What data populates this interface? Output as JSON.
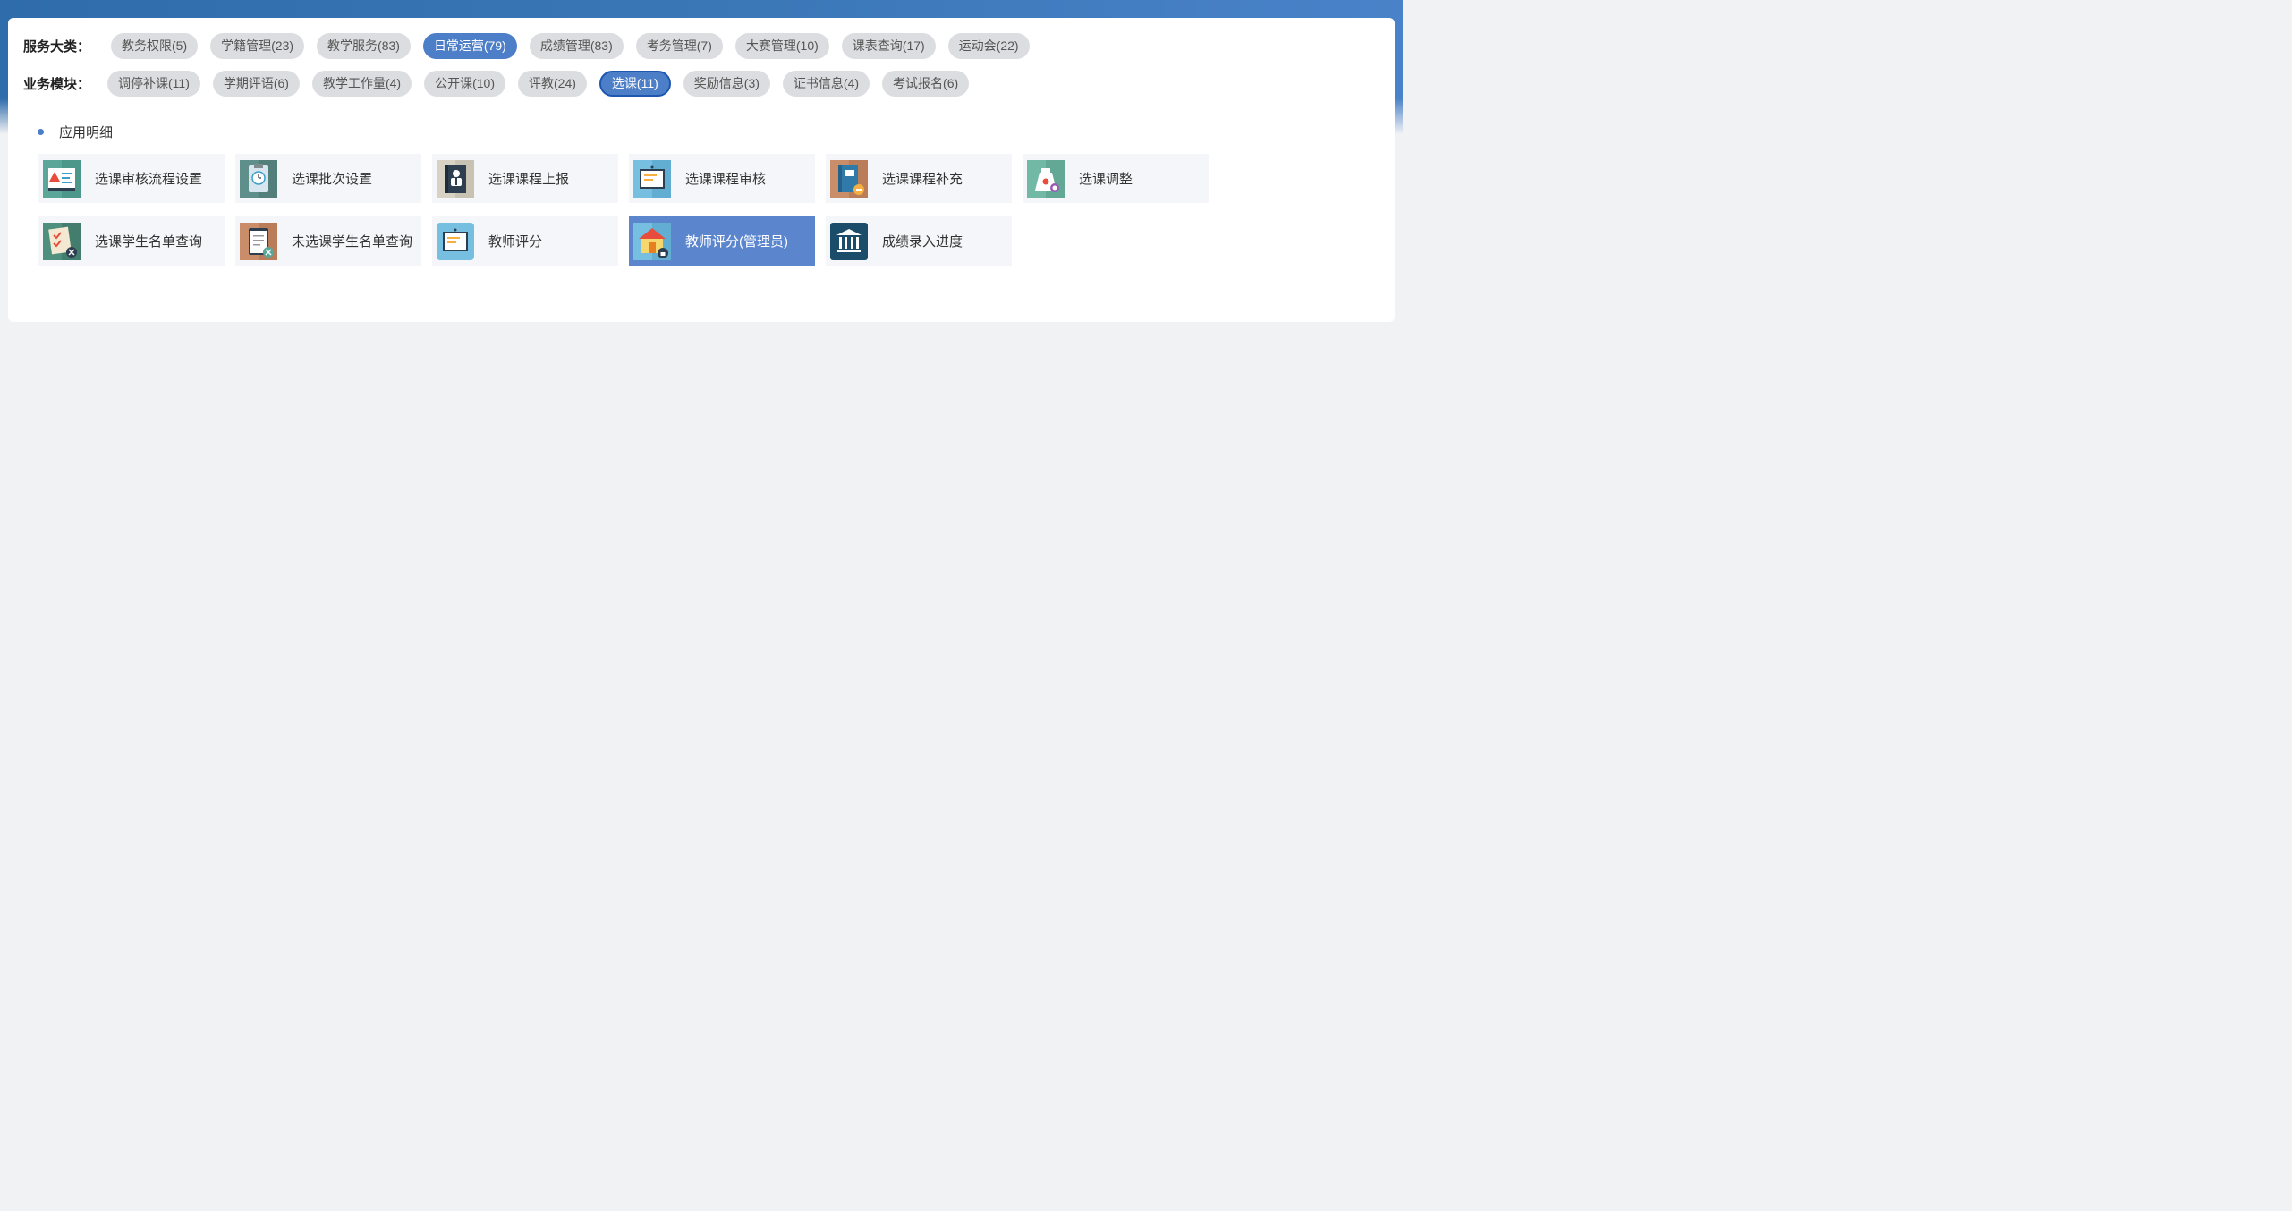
{
  "filters": {
    "service_label": "服务大类：",
    "service_categories": [
      "教务权限(5)",
      "学籍管理(23)",
      "教学服务(83)",
      "日常运营(79)",
      "成绩管理(83)",
      "考务管理(7)",
      "大赛管理(10)",
      "课表查询(17)",
      "运动会(22)"
    ],
    "service_active_index": 3,
    "module_label": "业务模块：",
    "modules": [
      "调停补课(11)",
      "学期评语(6)",
      "教学工作量(4)",
      "公开课(10)",
      "评教(24)",
      "选课(11)",
      "奖励信息(3)",
      "证书信息(4)",
      "考试报名(6)"
    ],
    "module_active_index": 5
  },
  "section": {
    "title": "应用明细"
  },
  "apps": [
    {
      "label": "选课审核流程设置",
      "icon": "warning-board-icon"
    },
    {
      "label": "选课批次设置",
      "icon": "clipboard-clock-icon"
    },
    {
      "label": "选课课程上报",
      "icon": "teacher-book-icon"
    },
    {
      "label": "选课课程审核",
      "icon": "notice-board-icon"
    },
    {
      "label": "选课课程补充",
      "icon": "book-wrench-icon"
    },
    {
      "label": "选课调整",
      "icon": "money-bag-search-icon"
    },
    {
      "label": "选课学生名单查询",
      "icon": "checklist-tools-icon"
    },
    {
      "label": "未选课学生名单查询",
      "icon": "clipboard-tools-icon"
    },
    {
      "label": "教师评分",
      "icon": "rating-board-icon"
    },
    {
      "label": "教师评分(管理员)",
      "icon": "house-lock-icon"
    },
    {
      "label": "成绩录入进度",
      "icon": "bank-building-icon"
    }
  ],
  "selected_app_index": 9,
  "colors": {
    "accent": "#4d7ec8",
    "selected_tile": "#5b86ce",
    "chip_bg": "#dcdde0",
    "header_blue": "#2f6cab"
  }
}
